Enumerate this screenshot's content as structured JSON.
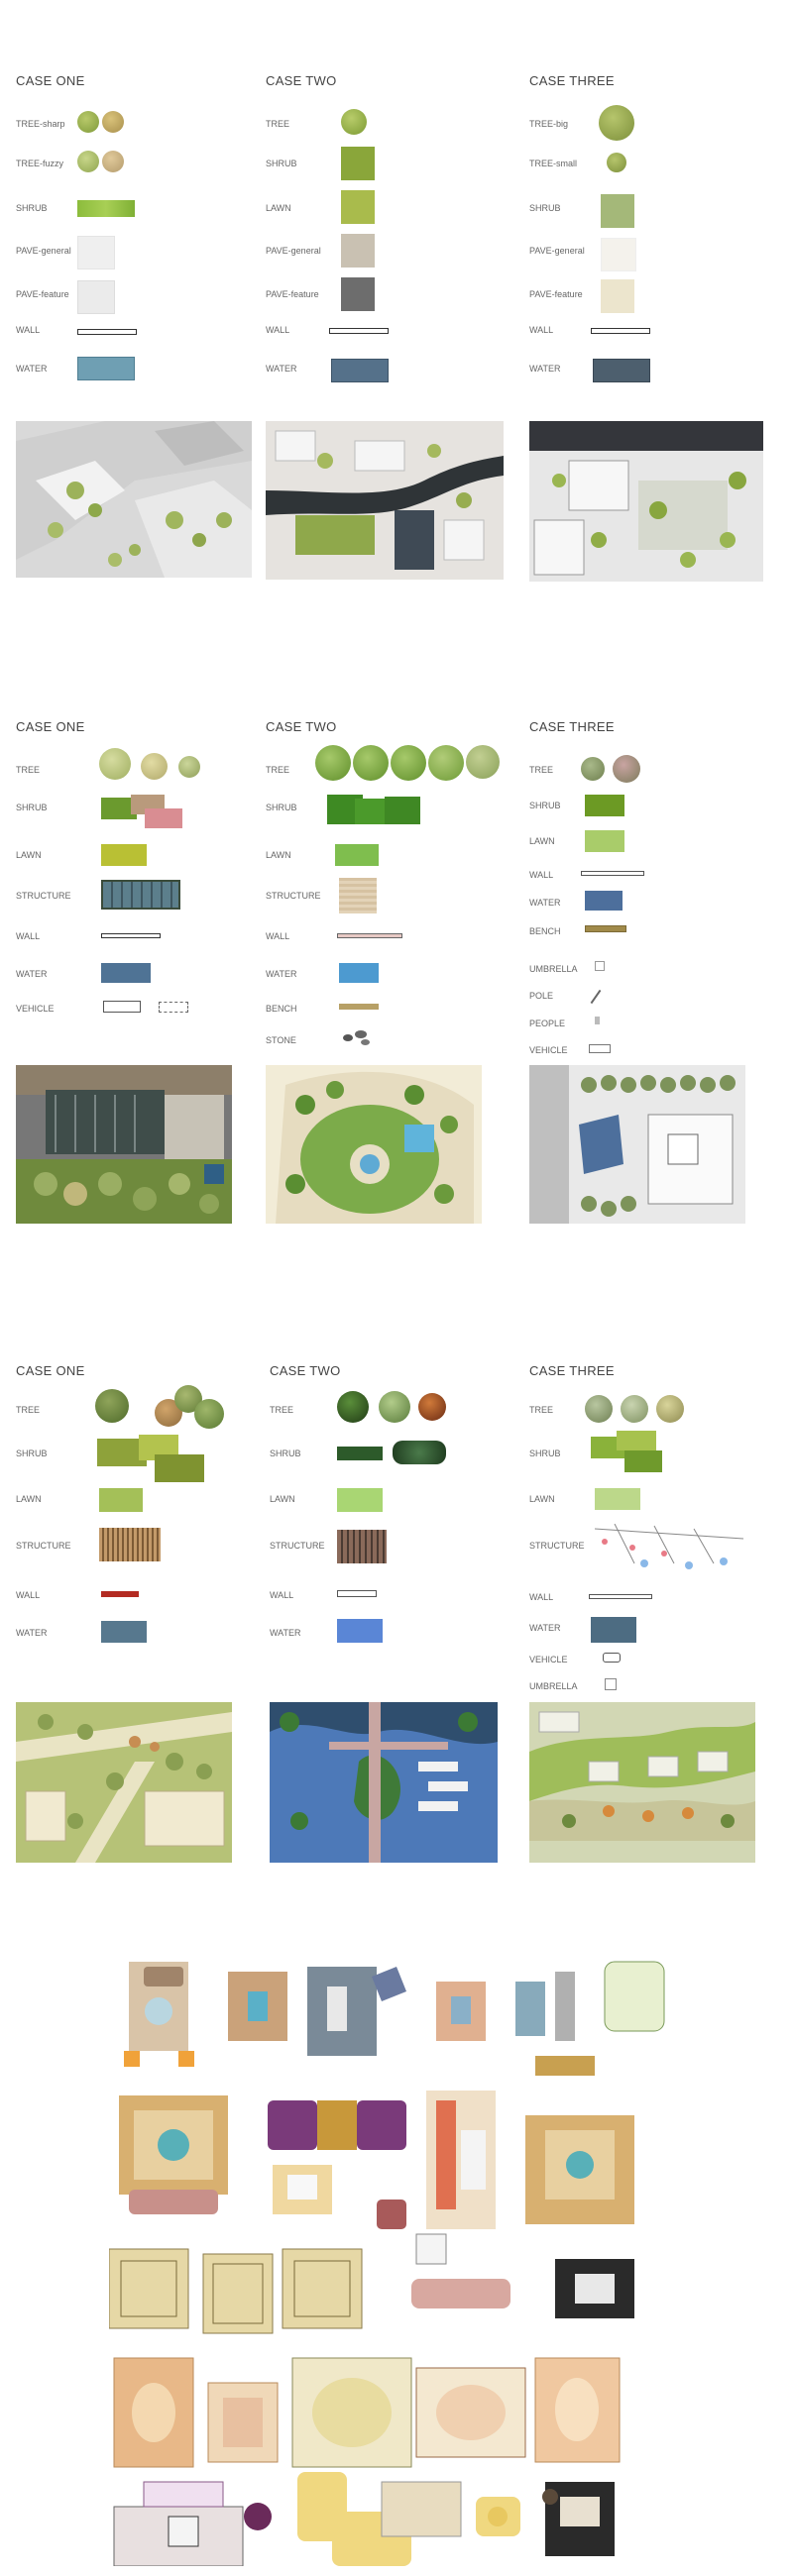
{
  "section1": {
    "case_one": {
      "title": "CASE ONE",
      "labels": [
        "TREE-sharp",
        "TREE-fuzzy",
        "SHRUB",
        "PAVE-general",
        "PAVE-feature",
        "WALL",
        "WATER"
      ]
    },
    "case_two": {
      "title": "CASE TWO",
      "labels": [
        "TREE",
        "SHRUB",
        "LAWN",
        "PAVE-general",
        "PAVE-feature",
        "WALL",
        "WATER"
      ]
    },
    "case_three": {
      "title": "CASE THREE",
      "labels": [
        "TREE-big",
        "TREE-small",
        "SHRUB",
        "PAVE-general",
        "PAVE-feature",
        "WALL",
        "WATER"
      ]
    }
  },
  "section2": {
    "case_one": {
      "title": "CASE ONE",
      "labels": [
        "TREE",
        "SHRUB",
        "LAWN",
        "STRUCTURE",
        "WALL",
        "WATER",
        "VEHICLE"
      ]
    },
    "case_two": {
      "title": "CASE TWO",
      "labels": [
        "TREE",
        "SHRUB",
        "LAWN",
        "STRUCTURE",
        "WALL",
        "WATER",
        "BENCH",
        "STONE"
      ]
    },
    "case_three": {
      "title": "CASE THREE",
      "labels": [
        "TREE",
        "SHRUB",
        "LAWN",
        "WALL",
        "WATER",
        "BENCH",
        "UMBRELLA",
        "POLE",
        "PEOPLE",
        "VEHICLE"
      ]
    }
  },
  "section3": {
    "case_one": {
      "title": "CASE ONE",
      "labels": [
        "TREE",
        "SHRUB",
        "LAWN",
        "STRUCTURE",
        "WALL",
        "WATER"
      ]
    },
    "case_two": {
      "title": "CASE TWO",
      "labels": [
        "TREE",
        "SHRUB",
        "LAWN",
        "STRUCTURE",
        "WALL",
        "WATER"
      ]
    },
    "case_three": {
      "title": "CASE THREE",
      "labels": [
        "TREE",
        "SHRUB",
        "LAWN",
        "STRUCTURE",
        "WALL",
        "WATER",
        "VEHICLE",
        "UMBRELLA"
      ]
    }
  },
  "colors": {
    "water_blue": "#6f9fb3",
    "water_slate": "#55718a",
    "water_dark": "#4d5f6e",
    "lawn_green": "#a8bd47",
    "shrub_green": "#8ab43c",
    "pave_light": "#eeeeee"
  }
}
